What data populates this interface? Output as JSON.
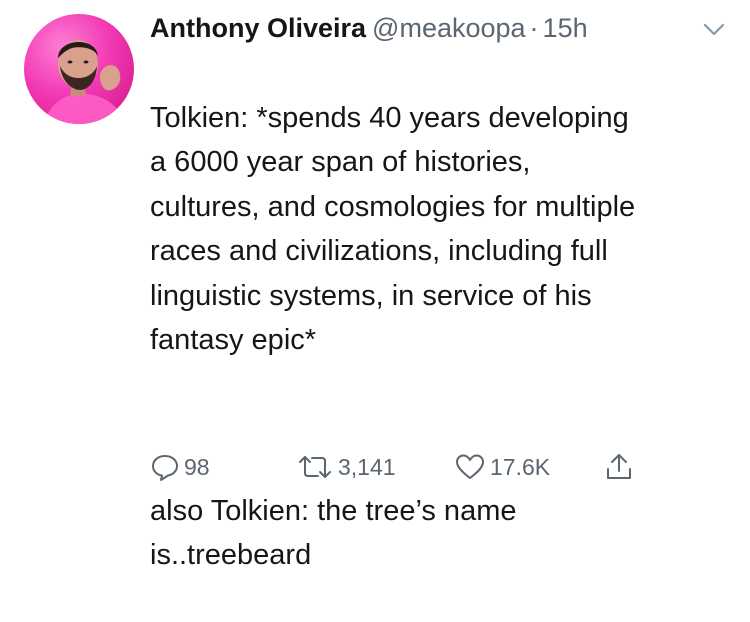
{
  "user": {
    "name": "Anthony Oliveira",
    "handle": "@meakoopa",
    "separator": "·",
    "time": "15h"
  },
  "tweet": {
    "paragraph_1": "Tolkien: *spends 40 years developing\na 6000 year span of histories,\ncultures, and cosmologies for multiple\nraces and civilizations, including full\nlinguistic systems, in service of his\nfantasy epic*",
    "paragraph_2": "also Tolkien: the tree’s name\nis..treebeard"
  },
  "actions": {
    "replies": "98",
    "retweets": "3,141",
    "likes": "17.6K"
  },
  "icons": {
    "reply": "reply-icon",
    "retweet": "retweet-icon",
    "like": "heart-icon",
    "share": "share-icon",
    "menu": "chevron-down-icon"
  },
  "colors": {
    "text": "#14171a",
    "muted": "#5b6670",
    "avatar_bg": "#f23ab5"
  }
}
